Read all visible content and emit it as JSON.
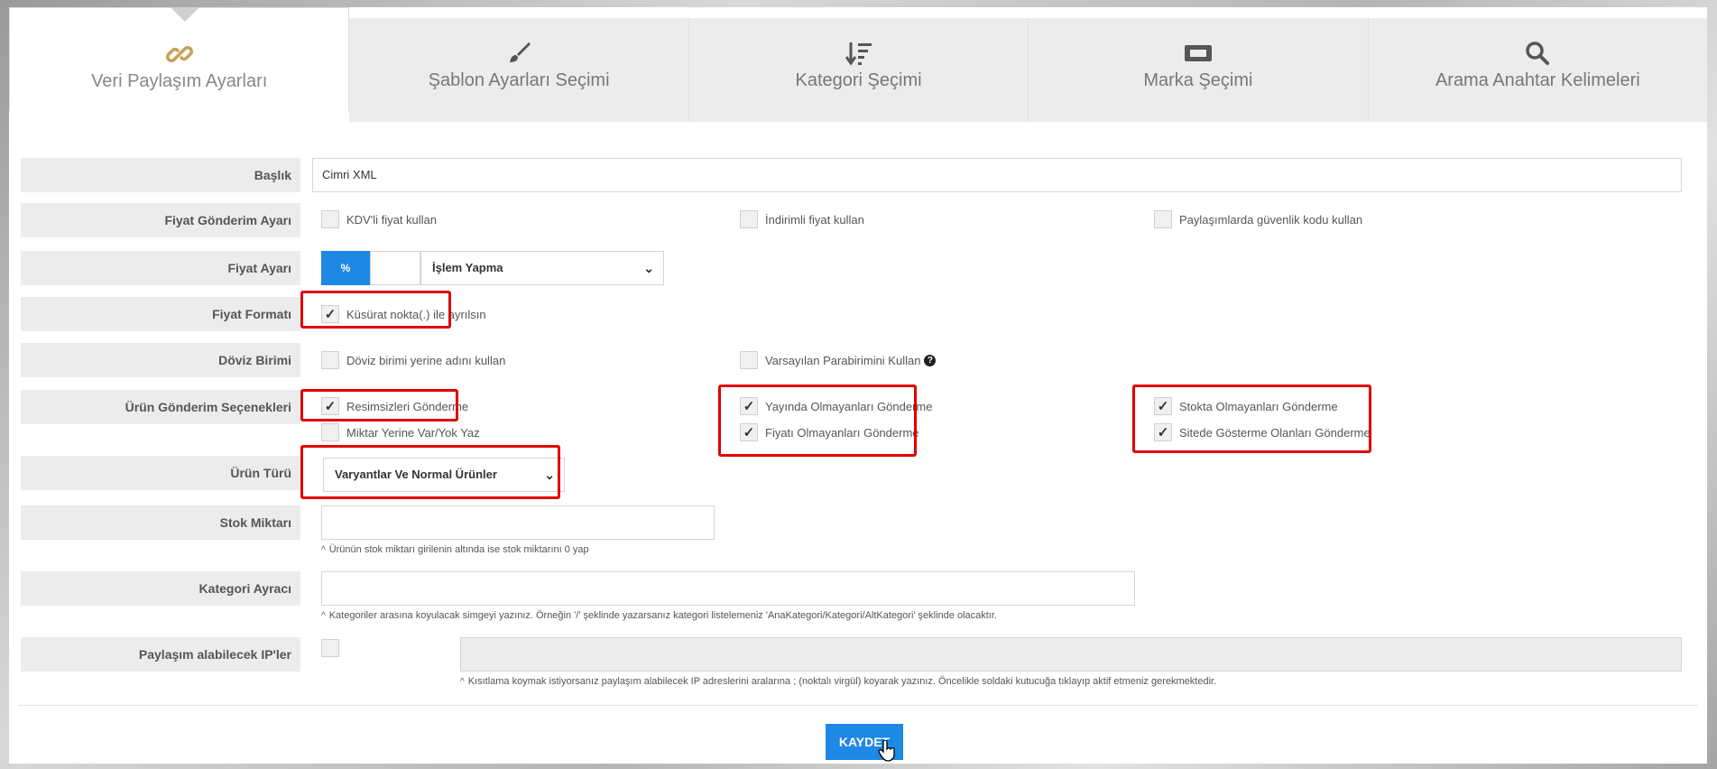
{
  "tabs": [
    {
      "label": "Veri Paylaşım Ayarları",
      "icon": "link-icon",
      "active": true
    },
    {
      "label": "Şablon Ayarları Seçimi",
      "icon": "brush-icon",
      "active": false
    },
    {
      "label": "Kategori Şeçimi",
      "icon": "sort-icon",
      "active": false
    },
    {
      "label": "Marka Şeçimi",
      "icon": "ticket-icon",
      "active": false
    },
    {
      "label": "Arama Anahtar Kelimeleri",
      "icon": "search-icon",
      "active": false
    }
  ],
  "form": {
    "baslik": {
      "label": "Başlık",
      "value": "Cimri XML"
    },
    "fiyat_gonderim": {
      "label": "Fiyat Gönderim Ayarı",
      "options": [
        "KDV'li fiyat kullan",
        "İndirimli fiyat kullan",
        "Paylaşımlarda güvenlik kodu kullan"
      ]
    },
    "fiyat_ayari": {
      "label": "Fiyat Ayarı",
      "unit": "%",
      "amount": "",
      "select_value": "İşlem Yapma"
    },
    "fiyat_formati": {
      "label": "Fiyat Formatı",
      "option": "Küsürat nokta(.) ile ayrılsın"
    },
    "doviz_birimi": {
      "label": "Döviz Birimi",
      "options": [
        "Döviz birimi yerine adını kullan",
        "Varsayılan Parabirimini Kullan"
      ]
    },
    "urun_gonderim": {
      "label": "Ürün Gönderim Seçenekleri",
      "options": [
        "Resimsizleri Gönderme",
        "Miktar Yerine Var/Yok Yaz",
        "Yayında Olmayanları Gönderme",
        "Fiyatı Olmayanları Gönderme",
        "Stokta Olmayanları Gönderme",
        "Sitede Gösterme Olanları Gönderme"
      ]
    },
    "urun_turu": {
      "label": "Ürün Türü",
      "select_value": "Varyantlar Ve Normal Ürünler"
    },
    "stok_miktari": {
      "label": "Stok Miktarı",
      "value": "",
      "hint": "Ürünün stok miktarı girilenin altında ise stok miktarını 0 yap"
    },
    "kategori_ayraci": {
      "label": "Kategori Ayracı",
      "value": "",
      "hint": "Kategoriler arasına koyulacak simgeyi yazınız. Örneğin '/' şeklinde yazarsanız kategori listelemeniz 'AnaKategori/Kategori/AltKategori' şeklinde olacaktır."
    },
    "ip": {
      "label": "Paylaşım alabilecek IP'ler",
      "value": "",
      "hint": "Kısıtlama koymak istiyorsanız paylaşım alabilecek IP adreslerini aralarına ; (noktalı virgül) koyarak yazınız. Öncelikle soldaki kutucuğa tıklayıp aktif etmeniz gerekmektedir."
    }
  },
  "save_label": "KAYDET",
  "colors": {
    "accent": "#1e88e5",
    "highlight": "#e00000",
    "tab_icon_active": "#c9a15a"
  }
}
